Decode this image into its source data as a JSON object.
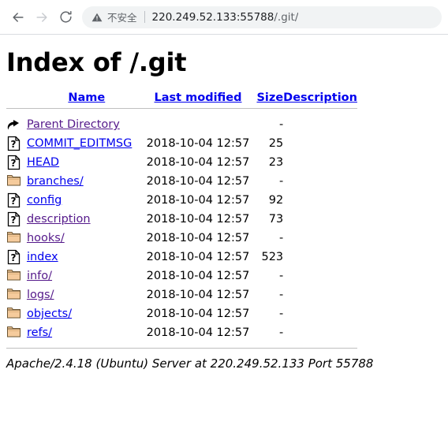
{
  "browser": {
    "back_label": "Back",
    "forward_label": "Forward",
    "reload_label": "Reload",
    "security_text": "不安全",
    "url_host": "220.249.52.133:55788",
    "url_path": "/.git/"
  },
  "page": {
    "title": "Index of /.git",
    "columns": {
      "name": "Name",
      "last_modified": "Last modified",
      "size": "Size",
      "description": "Description"
    },
    "entries": [
      {
        "icon": "parent-directory-icon",
        "name": "Parent Directory",
        "date": "",
        "size": "-",
        "description": "",
        "visited": true
      },
      {
        "icon": "unknown-file-icon",
        "name": "COMMIT_EDITMSG",
        "date": "2018-10-04 12:57",
        "size": "25",
        "description": "",
        "visited": false
      },
      {
        "icon": "unknown-file-icon",
        "name": "HEAD",
        "date": "2018-10-04 12:57",
        "size": "23",
        "description": "",
        "visited": false
      },
      {
        "icon": "folder-icon",
        "name": "branches/",
        "date": "2018-10-04 12:57",
        "size": "-",
        "description": "",
        "visited": false
      },
      {
        "icon": "unknown-file-icon",
        "name": "config",
        "date": "2018-10-04 12:57",
        "size": "92",
        "description": "",
        "visited": false
      },
      {
        "icon": "unknown-file-icon",
        "name": "description",
        "date": "2018-10-04 12:57",
        "size": "73",
        "description": "",
        "visited": true
      },
      {
        "icon": "folder-icon",
        "name": "hooks/",
        "date": "2018-10-04 12:57",
        "size": "-",
        "description": "",
        "visited": true
      },
      {
        "icon": "unknown-file-icon",
        "name": "index",
        "date": "2018-10-04 12:57",
        "size": "523",
        "description": "",
        "visited": false
      },
      {
        "icon": "folder-icon",
        "name": "info/",
        "date": "2018-10-04 12:57",
        "size": "-",
        "description": "",
        "visited": true
      },
      {
        "icon": "folder-icon",
        "name": "logs/",
        "date": "2018-10-04 12:57",
        "size": "-",
        "description": "",
        "visited": true
      },
      {
        "icon": "folder-icon",
        "name": "objects/",
        "date": "2018-10-04 12:57",
        "size": "-",
        "description": "",
        "visited": false
      },
      {
        "icon": "folder-icon",
        "name": "refs/",
        "date": "2018-10-04 12:57",
        "size": "-",
        "description": "",
        "visited": false
      }
    ],
    "server_signature": "Apache/2.4.18 (Ubuntu) Server at 220.249.52.133 Port 55788"
  },
  "colors": {
    "link": "#0000ee",
    "link_visited": "#551a8b",
    "folder": "#f5cb9c",
    "rule": "#bfbfbf",
    "omnibox_bg": "#f1f3f4",
    "url_host": "#202124",
    "url_path": "#5f6368"
  }
}
